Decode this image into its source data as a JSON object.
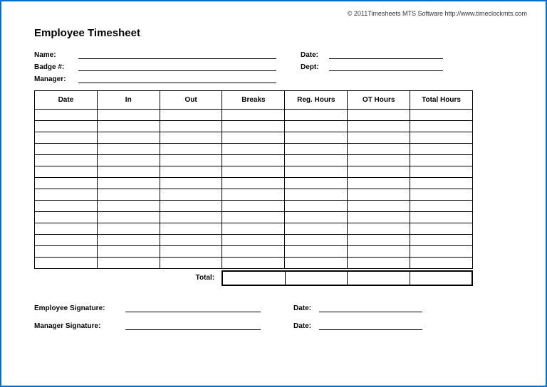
{
  "copyright": "© 2011Timesheets MTS Software  http://www.timeclockmts.com",
  "title": "Employee Timesheet",
  "info": {
    "name_label": "Name:",
    "badge_label": "Badge #:",
    "manager_label": "Manager:",
    "date_label": "Date:",
    "dept_label": "Dept:"
  },
  "table": {
    "headers": {
      "date": "Date",
      "in": "In",
      "out": "Out",
      "breaks": "Breaks",
      "reg_hours": "Reg. Hours",
      "ot_hours": "OT Hours",
      "total_hours": "Total Hours"
    },
    "row_count": 14,
    "total_label": "Total:"
  },
  "signatures": {
    "employee_label": "Employee Signature:",
    "manager_label": "Manager Signature:",
    "date_label": "Date:"
  }
}
